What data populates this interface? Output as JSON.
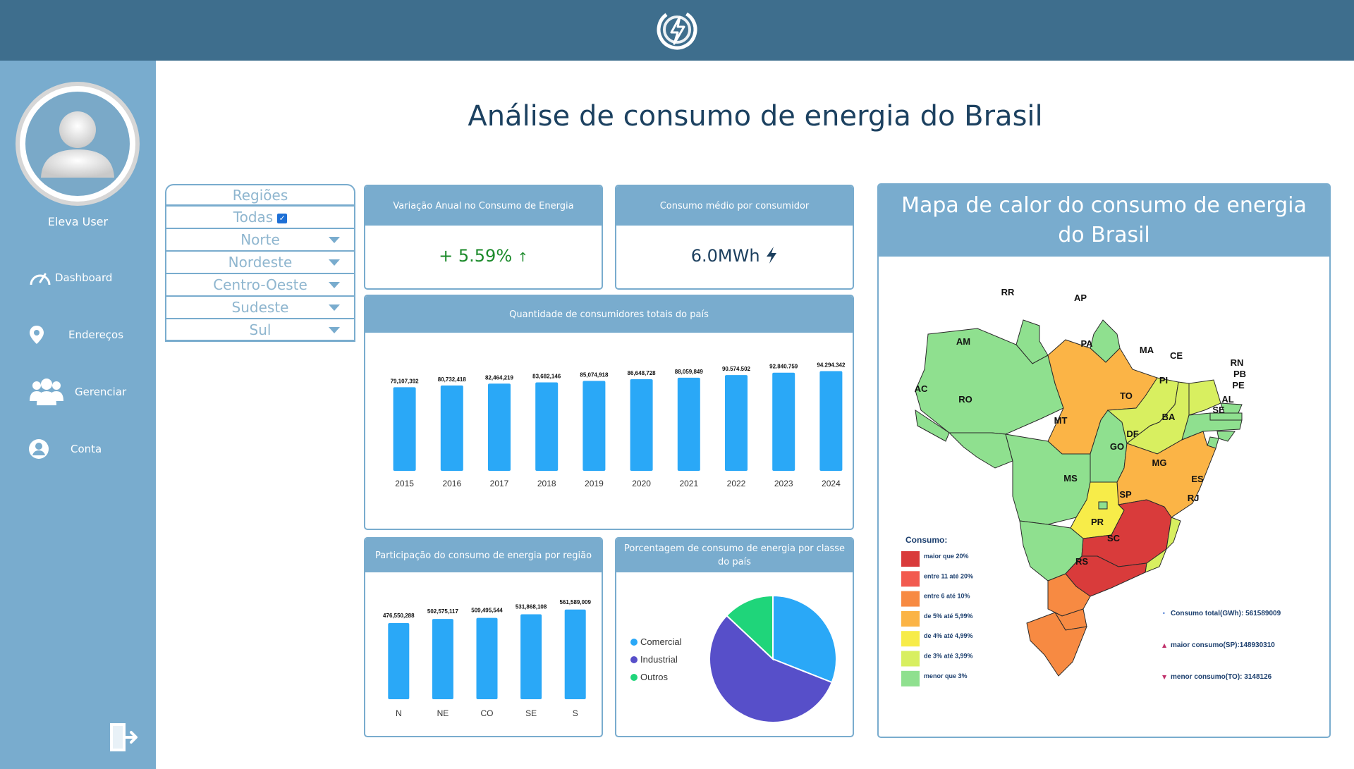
{
  "colors": {
    "topbar": "#3e6e8d",
    "sidebar": "#79acce",
    "bar": "#2aa8f7",
    "positive": "#1b8a2a",
    "pie_comercial": "#2aa8f7",
    "pie_industrial": "#574fc9",
    "pie_outros": "#1fd57a"
  },
  "header": {
    "logo_icon": "lightning-bolt-icon"
  },
  "sidebar": {
    "user": "Eleva User",
    "nav": [
      {
        "label": "Dashboard",
        "icon": "speedometer-icon"
      },
      {
        "label": "Endereços",
        "icon": "location-pin-icon"
      },
      {
        "label": "Gerenciar",
        "icon": "users-icon"
      },
      {
        "label": "Conta",
        "icon": "account-icon"
      }
    ],
    "logout_icon": "logout-icon"
  },
  "page": {
    "title": "Análise de consumo de energia do Brasil"
  },
  "filters": {
    "title": "Regiões",
    "items": [
      "Todas",
      "Norte",
      "Nordeste",
      "Centro-Oeste",
      "Sudeste",
      "Sul"
    ],
    "todas_checked": true
  },
  "kpis": {
    "variation": {
      "title": "Variação Anual no Consumo de Energia",
      "value": "+ 5.59%",
      "trend_icon": "arrow-up-icon"
    },
    "avg": {
      "title": "Consumo médio por consumidor",
      "value": "6.0MWh",
      "icon": "lightning-bolt-icon"
    }
  },
  "consumers_chart": {
    "title": "Quantidade de consumidores totais do país",
    "chart_data": {
      "type": "bar",
      "categories": [
        "2015",
        "2016",
        "2017",
        "2018",
        "2019",
        "2020",
        "2021",
        "2022",
        "2023",
        "2024"
      ],
      "values": [
        79107392,
        80732418,
        82464219,
        83682146,
        85074918,
        86648728,
        88059849,
        90574502,
        92840759,
        94294342
      ],
      "labels": [
        "79,107,392",
        "80,732,418",
        "82,464,219",
        "83,682,146",
        "85,074,918",
        "86,648,728",
        "88,059,849",
        "90.574.502",
        "92.840.759",
        "94.294.342"
      ],
      "ylim": [
        0,
        100000000
      ]
    }
  },
  "region_chart": {
    "title": "Participação do consumo de energia por região",
    "chart_data": {
      "type": "bar",
      "categories": [
        "N",
        "NE",
        "CO",
        "SE",
        "S"
      ],
      "values": [
        476550288,
        502575117,
        509495544,
        531868108,
        561589009
      ],
      "labels": [
        "476,550,288",
        "502,575,117",
        "509,495,544",
        "531,868,108",
        "561,589,009"
      ],
      "ylim": [
        0,
        700000000
      ]
    }
  },
  "class_chart": {
    "title": "Porcentagem de consumo de energia por classe do país",
    "chart_data": {
      "type": "pie",
      "categories": [
        "Comercial",
        "Industrial",
        "Outros"
      ],
      "values": [
        31,
        56,
        13
      ]
    }
  },
  "map": {
    "title": "Mapa de calor do consumo de energia do Brasil",
    "legend_title": "Consumo:",
    "legend": [
      {
        "label": "maior que 20%",
        "color": "#d93b3b"
      },
      {
        "label": "entre 11 até 20%",
        "color": "#f25a4f"
      },
      {
        "label": "entre 6 até 10%",
        "color": "#f78a42"
      },
      {
        "label": "de 5% até 5,99%",
        "color": "#fbb446"
      },
      {
        "label": "de 4% até 4,99%",
        "color": "#f7ec49"
      },
      {
        "label": "de 3% até 3,99%",
        "color": "#d8ef60"
      },
      {
        "label": "menor que 3%",
        "color": "#8fe08f"
      }
    ],
    "stats": [
      {
        "text": "Consumo total(GWh): 561589009",
        "marker": "•"
      },
      {
        "text": "maior consumo(SP):148930310",
        "marker": "▲"
      },
      {
        "text": "menor consumo(TO): 3148126",
        "marker": "▼"
      }
    ],
    "states": [
      "RR",
      "AP",
      "AM",
      "PA",
      "MA",
      "CE",
      "RN",
      "PB",
      "PE",
      "AL",
      "SE",
      "PI",
      "AC",
      "RO",
      "TO",
      "BA",
      "MT",
      "DF",
      "GO",
      "MG",
      "ES",
      "MS",
      "RJ",
      "SP",
      "PR",
      "SC",
      "RS"
    ]
  }
}
